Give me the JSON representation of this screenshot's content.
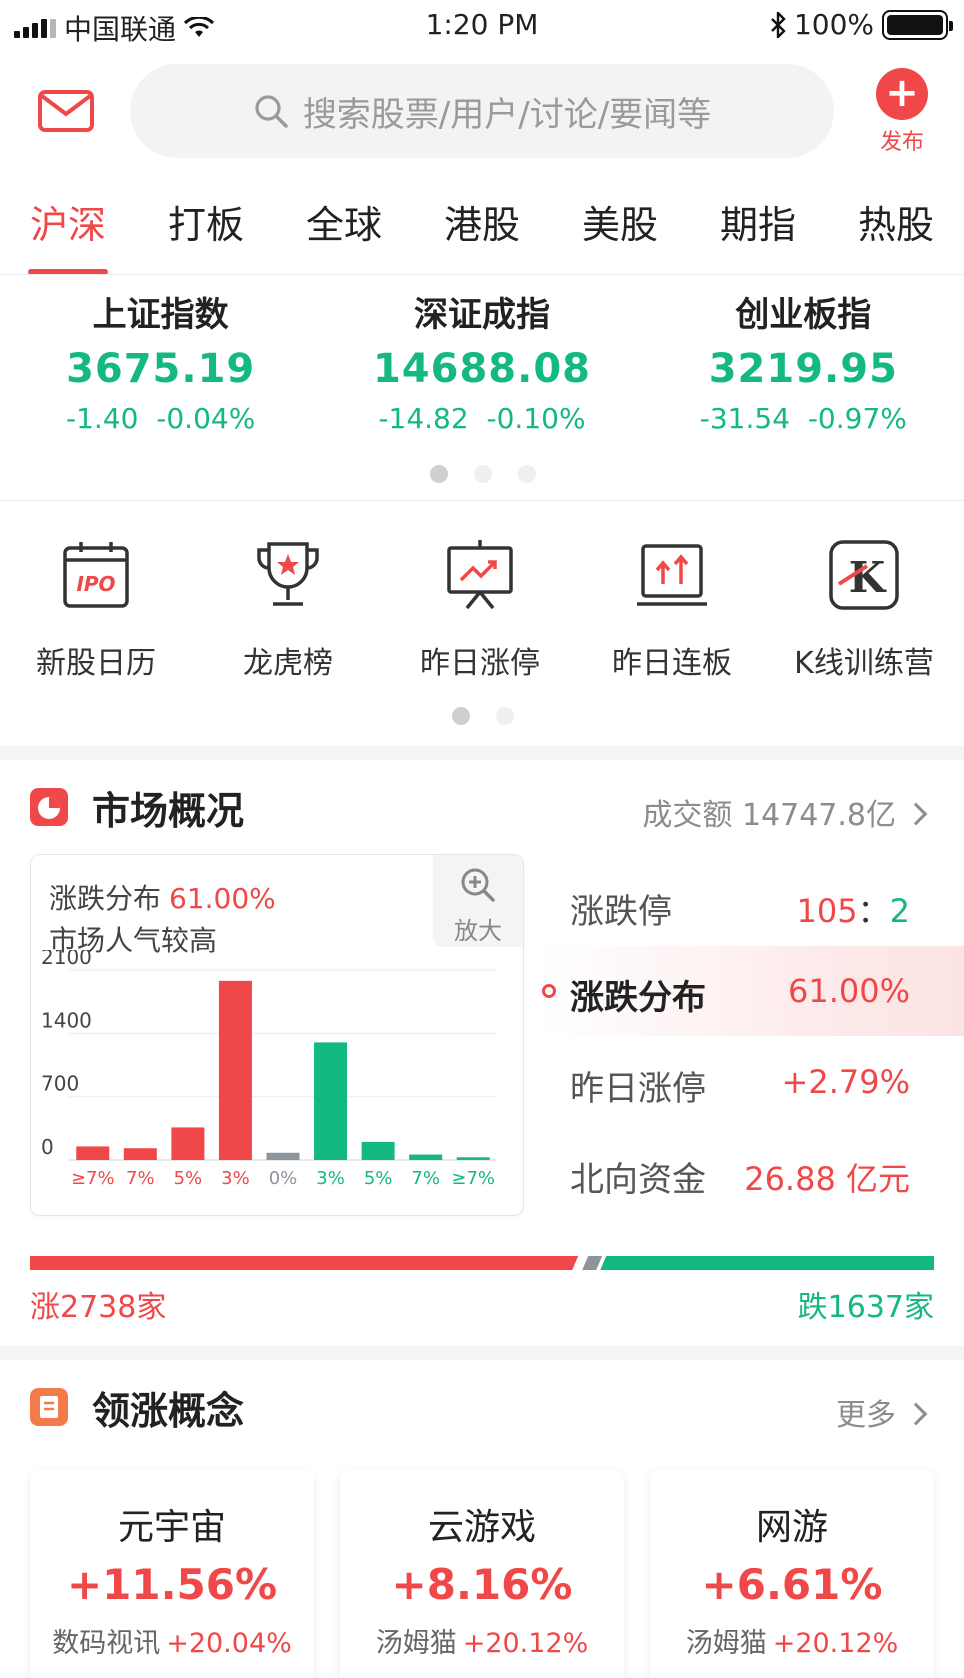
{
  "status_bar": {
    "carrier": "中国联通",
    "time": "1:20 PM",
    "battery_pct": "100%"
  },
  "header": {
    "search_placeholder": "搜索股票/用户/讨论/要闻等",
    "publish_label": "发布"
  },
  "tabs": [
    {
      "label": "沪深",
      "active": true
    },
    {
      "label": "打板"
    },
    {
      "label": "全球"
    },
    {
      "label": "港股"
    },
    {
      "label": "美股"
    },
    {
      "label": "期指"
    },
    {
      "label": "热股"
    }
  ],
  "indices": [
    {
      "name": "上证指数",
      "value": "3675.19",
      "change": "-1.40",
      "pct": "-0.04%"
    },
    {
      "name": "深证成指",
      "value": "14688.08",
      "change": "-14.82",
      "pct": "-0.10%"
    },
    {
      "name": "创业板指",
      "value": "3219.95",
      "change": "-31.54",
      "pct": "-0.97%"
    }
  ],
  "tools": [
    {
      "label": "新股日历",
      "icon": "ipo-calendar-icon"
    },
    {
      "label": "龙虎榜",
      "icon": "trophy-icon"
    },
    {
      "label": "昨日涨停",
      "icon": "rising-chart-board-icon"
    },
    {
      "label": "昨日连板",
      "icon": "double-arrow-up-board-icon"
    },
    {
      "label": "K线训练营",
      "icon": "k-line-icon"
    }
  ],
  "market": {
    "title": "市场概况",
    "turnover_label": "成交额",
    "turnover_value": "14747.8亿",
    "chart_title": "涨跌分布",
    "chart_title_value": "61.00%",
    "chart_subtitle": "市场人气较高",
    "zoom_label": "放大",
    "stats": [
      {
        "label": "涨跌停",
        "up": "105",
        "sep": "：",
        "down": "2"
      },
      {
        "label": "涨跌分布",
        "value": "61.00%",
        "selected": true
      },
      {
        "label": "昨日涨停",
        "value": "+2.79%"
      },
      {
        "label": "北向资金",
        "value": "26.88 亿元"
      }
    ],
    "rise_label": "涨2738家",
    "fall_label": "跌1637家",
    "rise_count": 2738,
    "fall_count": 1637
  },
  "chart_data": {
    "type": "bar",
    "categories": [
      "≥7%",
      "7%",
      "5%",
      "3%",
      "0%",
      "3%",
      "5%",
      "7%",
      "≥7%"
    ],
    "values": [
      150,
      130,
      360,
      1980,
      80,
      1300,
      200,
      60,
      30
    ],
    "colors": [
      "#f04848",
      "#f04848",
      "#f04848",
      "#f04848",
      "#8e949c",
      "#14b97f",
      "#14b97f",
      "#14b97f",
      "#14b97f"
    ],
    "ytick_labels": [
      "2100",
      "1400",
      "700",
      "0"
    ],
    "ylim": [
      0,
      2100
    ],
    "grid": true
  },
  "concepts": {
    "title": "领涨概念",
    "more_label": "更多",
    "items": [
      {
        "name": "元宇宙",
        "pct": "+11.56%",
        "leader": "数码视讯",
        "leader_pct": "+20.04%"
      },
      {
        "name": "云游戏",
        "pct": "+8.16%",
        "leader": "汤姆猫",
        "leader_pct": "+20.12%"
      },
      {
        "name": "网游",
        "pct": "+6.61%",
        "leader": "汤姆猫",
        "leader_pct": "+20.12%"
      }
    ]
  },
  "colors": {
    "red": "#f04848",
    "green": "#14b97f",
    "gray": "#8e949c"
  }
}
